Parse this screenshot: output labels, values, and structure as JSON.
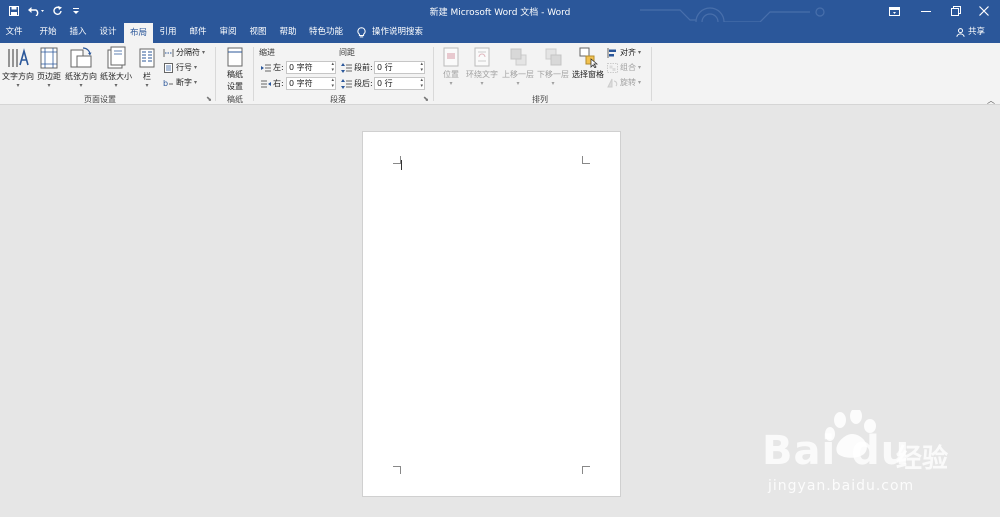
{
  "window": {
    "title": "新建 Microsoft Word 文档 - Word"
  },
  "quick_access": {
    "icons": [
      "save-icon",
      "undo-icon",
      "redo-icon",
      "customize-icon"
    ]
  },
  "tabs": [
    {
      "label": "文件"
    },
    {
      "label": "开始"
    },
    {
      "label": "插入"
    },
    {
      "label": "设计"
    },
    {
      "label": "布局"
    },
    {
      "label": "引用"
    },
    {
      "label": "邮件"
    },
    {
      "label": "审阅"
    },
    {
      "label": "视图"
    },
    {
      "label": "帮助"
    },
    {
      "label": "特色功能"
    }
  ],
  "active_tab": "布局",
  "tell_me": {
    "label": "操作说明搜索"
  },
  "share": {
    "label": "共享"
  },
  "ribbon": {
    "page_setup": {
      "label": "页面设置",
      "text_direction": "文字方向",
      "margins": "页边距",
      "orientation": "纸张方向",
      "size": "纸张大小",
      "columns": "栏",
      "breaks": "分隔符",
      "line_numbers": "行号",
      "hyphenation": "断字"
    },
    "manuscript": {
      "label": "稿纸",
      "button_line1": "稿纸",
      "button_line2": "设置"
    },
    "paragraph": {
      "label": "段落",
      "indent_title": "缩进",
      "spacing_title": "间距",
      "left_label": "左:",
      "left_value": "0 字符",
      "right_label": "右:",
      "right_value": "0 字符",
      "before_label": "段前:",
      "before_value": "0 行",
      "after_label": "段后:",
      "after_value": "0 行"
    },
    "arrange": {
      "label": "排列",
      "position": "位置",
      "wrap_text": "环绕文字",
      "bring_forward": "上移一层",
      "send_backward": "下移一层",
      "selection_pane": "选择窗格",
      "align": "对齐",
      "group": "组合",
      "rotate": "旋转"
    }
  },
  "watermark": {
    "logo": "Bai du",
    "cn": "经验",
    "url": "jingyan.baidu.com"
  }
}
